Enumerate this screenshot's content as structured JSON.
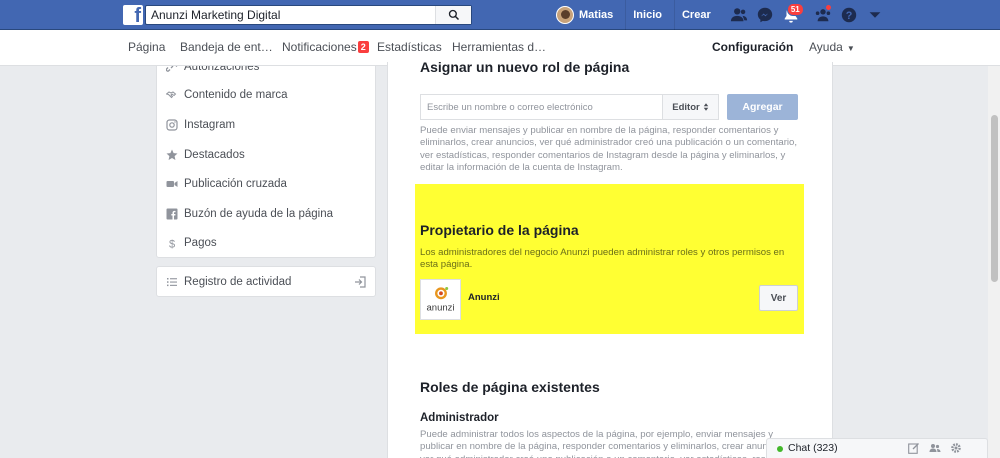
{
  "topbar": {
    "search_value": "Anunzi Marketing Digital",
    "user_name": "Matias",
    "home_label": "Inicio",
    "create_label": "Crear",
    "notifications_count": "51"
  },
  "page_nav": {
    "items": [
      {
        "label": "Página"
      },
      {
        "label": "Bandeja de ent…"
      },
      {
        "label": "Notificaciones",
        "count": "2"
      },
      {
        "label": "Estadísticas"
      },
      {
        "label": "Herramientas d…"
      },
      {
        "label": "Configuración"
      },
      {
        "label": "Ayuda"
      }
    ]
  },
  "sidebar": {
    "items": [
      {
        "label": "Autorizaciones",
        "icon": "link-icon"
      },
      {
        "label": "Contenido de marca",
        "icon": "handshake-icon"
      },
      {
        "label": "Instagram",
        "icon": "instagram-icon"
      },
      {
        "label": "Destacados",
        "icon": "star-icon"
      },
      {
        "label": "Publicación cruzada",
        "icon": "video-icon"
      },
      {
        "label": "Buzón de ayuda de la página",
        "icon": "facebook-square-icon"
      },
      {
        "label": "Pagos",
        "icon": "dollar-icon"
      }
    ],
    "activity_log": {
      "label": "Registro de actividad",
      "icon": "list-icon"
    }
  },
  "main": {
    "new_role": {
      "title": "Asignar un nuevo rol de página",
      "input_placeholder": "Escribe un nombre o correo electrónico",
      "role_select": "Editor",
      "add_button": "Agregar",
      "description": "Puede enviar mensajes y publicar en nombre de la página, responder comentarios y eliminarlos, crear anuncios, ver qué administrador creó una publicación o un comentario, ver estadísticas, responder comentarios de Instagram desde la página y eliminarlos, y editar la información de la cuenta de Instagram."
    },
    "owner": {
      "title": "Propietario de la página",
      "description": "Los administradores del negocio Anunzi pueden administrar roles y otros permisos en esta página.",
      "business_name": "Anunzi",
      "logo_text": "anunzi",
      "view_button": "Ver"
    },
    "existing_roles": {
      "title": "Roles de página existentes",
      "admin_title": "Administrador",
      "admin_description": "Puede administrar todos los aspectos de la página, por ejemplo, enviar mensajes y publicar en nombre de la página, responder comentarios y eliminarlos, crear anuncios, ver qué administrador creó una publicación o un comentario, ver estadísticas, responder comentarios"
    }
  },
  "chat": {
    "label": "Chat (323)"
  },
  "colors": {
    "brand_blue": "#4267b2",
    "highlight_yellow": "#ffff33",
    "badge_red": "#fa3e3e",
    "online_green": "#42b72a"
  }
}
